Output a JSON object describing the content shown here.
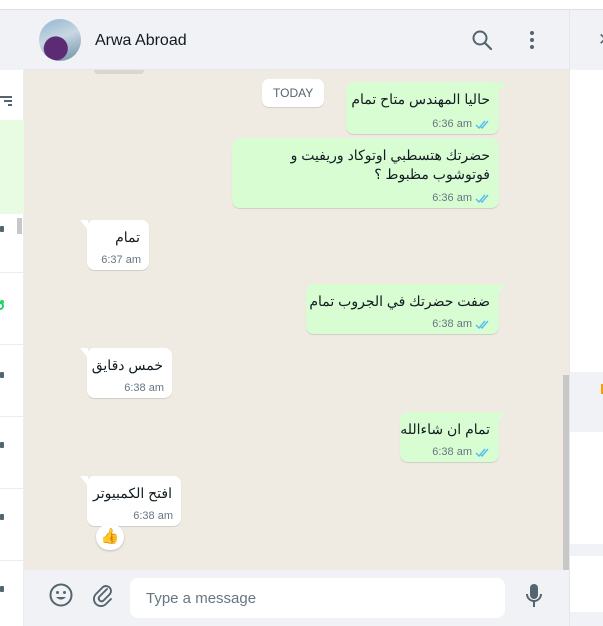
{
  "chat_header": {
    "contact_name": "Arwa Abroad"
  },
  "messages_area": {
    "date_divider": "TODAY",
    "messages": [
      {
        "direction": "outgoing",
        "text": "حاليا المهندس متاح تمام",
        "time": "6:36 am",
        "status": "read"
      },
      {
        "direction": "outgoing",
        "text": "حضرتك هتسطبي اوتوكاد وريفيت و\nفوتوشوب مظبوط ؟",
        "time": "6:36 am",
        "status": "read"
      },
      {
        "direction": "incoming",
        "text": "تمام",
        "time": "6:37 am"
      },
      {
        "direction": "outgoing",
        "text": "ضفت حضرتك في الجروب تمام",
        "time": "6:38 am",
        "status": "read"
      },
      {
        "direction": "incoming",
        "text": "خمس دقايق",
        "time": "6:38 am"
      },
      {
        "direction": "outgoing",
        "text": "تمام ان شاءالله",
        "time": "6:38 am",
        "status": "read"
      },
      {
        "direction": "incoming",
        "text": "افتح الكمبيوتر",
        "time": "6:38 am",
        "reaction": "👍"
      }
    ]
  },
  "composer": {
    "placeholder": "Type a message"
  },
  "colors": {
    "outgoing_bubble": "#d9fdd3",
    "incoming_bubble": "#ffffff",
    "chat_background": "#efeae2",
    "read_ticks": "#53bdeb",
    "header_background": "#f0f2f5"
  },
  "icons": [
    "search-icon",
    "menu-icon",
    "emoji-icon",
    "attach-icon",
    "mic-icon",
    "filter-icon",
    "close-icon",
    "read-ticks-icon"
  ]
}
